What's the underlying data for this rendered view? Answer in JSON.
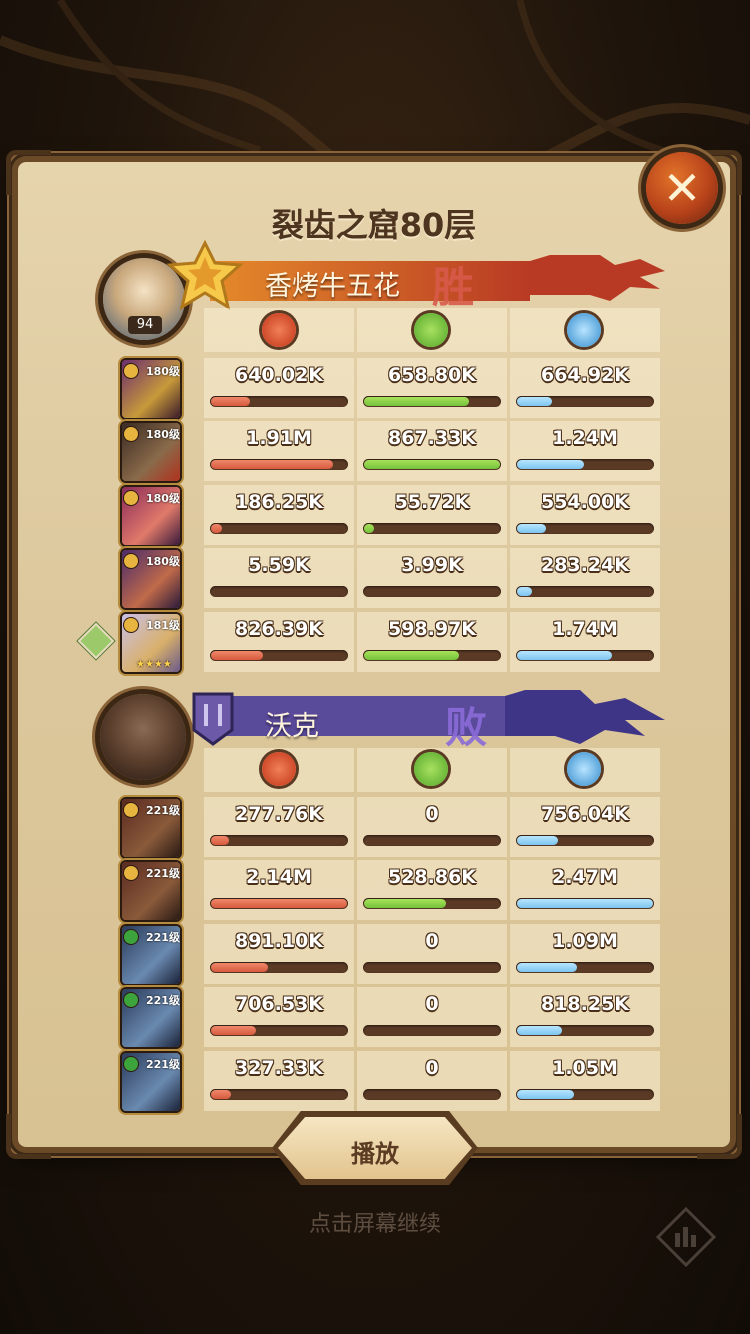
{
  "header": {
    "title": "裂齿之窟80层",
    "close_icon": "close-icon"
  },
  "columns": {
    "icons": [
      "damage-icon",
      "heal-icon",
      "shield-icon"
    ],
    "colors": {
      "damage": "#e06044",
      "heal": "#7cc640",
      "tank": "#8acbf2"
    }
  },
  "team_win": {
    "name": "香烤牛五花",
    "result": "胜",
    "player_level": "94",
    "heroes": [
      {
        "level": "180级",
        "dmg": "640.02K",
        "heal": "658.80K",
        "tank": "664.92K",
        "dmg_pct": 0.29,
        "heal_pct": 0.77,
        "tank_pct": 0.26
      },
      {
        "level": "180级",
        "dmg": "1.91M",
        "heal": "867.33K",
        "tank": "1.24M",
        "dmg_pct": 0.9,
        "heal_pct": 1.0,
        "tank_pct": 0.49
      },
      {
        "level": "180级",
        "dmg": "186.25K",
        "heal": "55.72K",
        "tank": "554.00K",
        "dmg_pct": 0.08,
        "heal_pct": 0.07,
        "tank_pct": 0.21
      },
      {
        "level": "180级",
        "dmg": "5.59K",
        "heal": "3.99K",
        "tank": "283.24K",
        "dmg_pct": 0.0,
        "heal_pct": 0.0,
        "tank_pct": 0.11
      },
      {
        "level": "181级",
        "dmg": "826.39K",
        "heal": "598.97K",
        "tank": "1.74M",
        "dmg_pct": 0.38,
        "heal_pct": 0.7,
        "tank_pct": 0.7,
        "stars": "★★★★"
      }
    ]
  },
  "team_lose": {
    "name": "沃克",
    "result": "败",
    "heroes": [
      {
        "level": "221级",
        "dmg": "277.76K",
        "heal": "0",
        "tank": "756.04K",
        "dmg_pct": 0.13,
        "heal_pct": 0,
        "tank_pct": 0.3
      },
      {
        "level": "221级",
        "dmg": "2.14M",
        "heal": "528.86K",
        "tank": "2.47M",
        "dmg_pct": 1.0,
        "heal_pct": 0.6,
        "tank_pct": 1.0
      },
      {
        "level": "221级",
        "dmg": "891.10K",
        "heal": "0",
        "tank": "1.09M",
        "dmg_pct": 0.42,
        "heal_pct": 0,
        "tank_pct": 0.44
      },
      {
        "level": "221级",
        "dmg": "706.53K",
        "heal": "0",
        "tank": "818.25K",
        "dmg_pct": 0.33,
        "heal_pct": 0,
        "tank_pct": 0.33
      },
      {
        "level": "221级",
        "dmg": "327.33K",
        "heal": "0",
        "tank": "1.05M",
        "dmg_pct": 0.15,
        "heal_pct": 0,
        "tank_pct": 0.42
      }
    ]
  },
  "footer": {
    "play_label": "播放",
    "hint": "点击屏幕继续",
    "stats_icon": "bar-chart-icon"
  }
}
